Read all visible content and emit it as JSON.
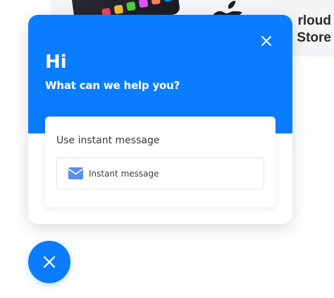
{
  "background": {
    "store_line1": "rloud",
    "store_line2": "Store"
  },
  "widget": {
    "greeting": "Hi",
    "subgreeting": "What can we help you?",
    "card": {
      "title": "Use instant message",
      "button_label": "Instant message",
      "button_icon": "envelope-icon"
    },
    "close_icon": "close-icon"
  },
  "launcher": {
    "icon": "close-icon"
  },
  "colors": {
    "accent": "#0a7cff",
    "text": "#3a3a3a"
  }
}
